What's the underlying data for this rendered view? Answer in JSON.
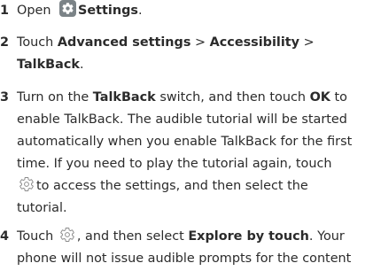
{
  "steps": [
    {
      "number": "1",
      "t1": "Open",
      "icon": "settings-app-icon",
      "bold1": "Settings",
      "t2": "."
    },
    {
      "number": "2",
      "t1": "Touch",
      "bold1": "Advanced settings",
      "sep1": ">",
      "bold2": "Accessibility",
      "sep2": ">",
      "bold3": "TalkBack",
      "t2": "."
    },
    {
      "number": "3",
      "t1": "Turn on the",
      "bold1": "TalkBack",
      "t2": "switch, and then touch",
      "bold2": "OK",
      "t3": "to",
      "line2": "enable TalkBack. The audible tutorial will be started",
      "line3": "automatically when you enable TalkBack for the first",
      "line4": "time. If you need to play the tutorial again, touch",
      "icon": "gear-outline-icon",
      "t4": "to access the settings, and then select the",
      "line6": "tutorial."
    },
    {
      "number": "4",
      "t1": "Touch",
      "icon": "gear-outline-icon",
      "t2": ", and then select",
      "bold1": "Explore by touch",
      "t3": ". Your",
      "line2": "phone will not issue audible prompts for the content"
    }
  ],
  "colors": {
    "text": "#2b2b2b",
    "settings_icon_bg": "#7b8387",
    "gear_outline": "#8a8a8a"
  }
}
